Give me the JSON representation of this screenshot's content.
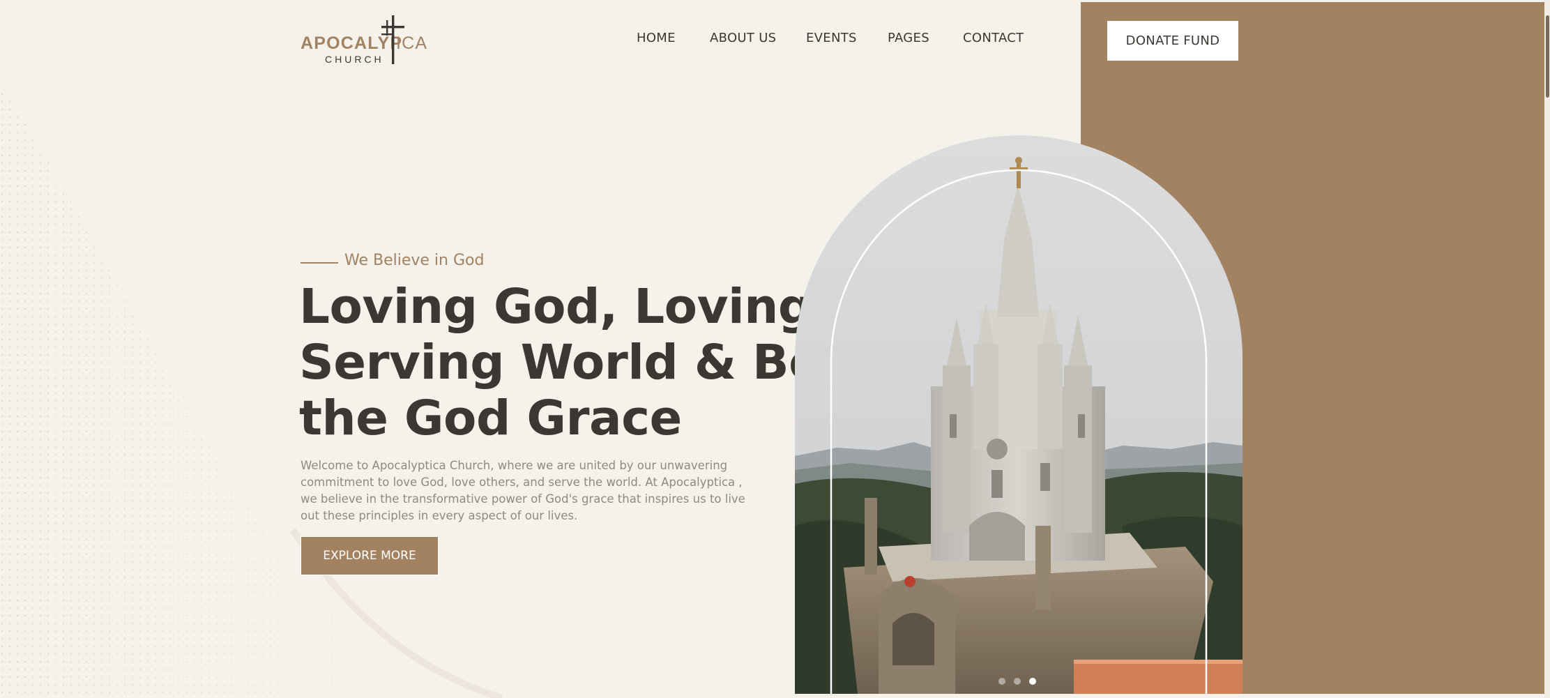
{
  "logo": {
    "word_left": "APOCALYP",
    "word_right": "ICA",
    "subtitle": "CHURCH"
  },
  "nav": {
    "items": [
      {
        "label": "HOME"
      },
      {
        "label": "ABOUT US"
      },
      {
        "label": "EVENTS"
      },
      {
        "label": "PAGES"
      },
      {
        "label": "CONTACT"
      }
    ]
  },
  "header": {
    "donate_label": "DONATE FUND"
  },
  "hero": {
    "tagline": "We Believe in God",
    "headline_lines": [
      "Loving God, Loving Others,",
      "Serving World & Believe in",
      "the God Grace"
    ],
    "intro": "Welcome to Apocalyptica Church, where we are united by our unwavering commitment to love God, love others, and serve the world. At Apocalyptica , we believe in the transformative power of God's grace that inspires us to live out these principles in every aspect of our lives.",
    "cta_label": "EXPLORE MORE"
  },
  "slider": {
    "count": 3,
    "active_index": 2
  },
  "colors": {
    "accent": "#a38262",
    "background": "#f5f2eb",
    "text_dark": "#3b3733",
    "text_muted": "#8d8984"
  },
  "icons": {
    "logo_cross": "cross-icon"
  }
}
